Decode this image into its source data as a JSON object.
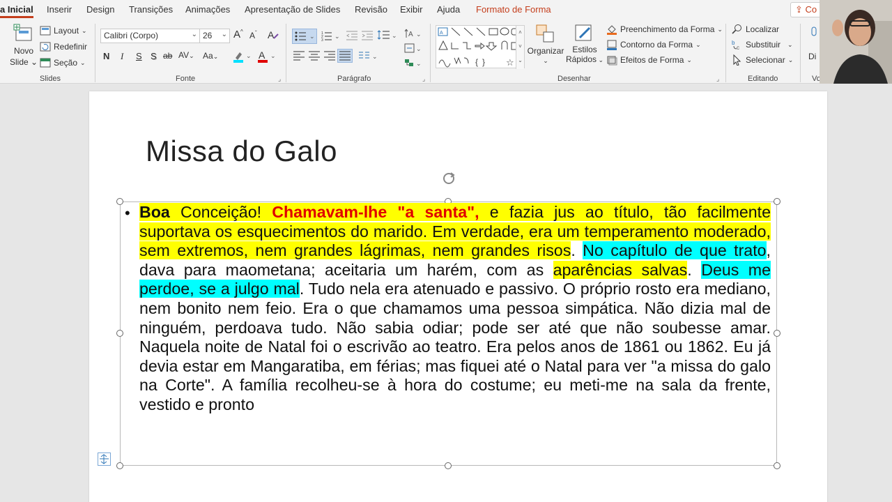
{
  "tabs": [
    {
      "label": "a Inicial",
      "active": true
    },
    {
      "label": "Inserir"
    },
    {
      "label": "Design"
    },
    {
      "label": "Transições"
    },
    {
      "label": "Animações"
    },
    {
      "label": "Apresentação de Slides"
    },
    {
      "label": "Revisão"
    },
    {
      "label": "Exibir"
    },
    {
      "label": "Ajuda"
    },
    {
      "label": "Formato de Forma",
      "accent": true
    }
  ],
  "share_label": "Co",
  "ribbon": {
    "slides": {
      "new_slide_label": "Novo",
      "new_slide_label2": "Slide",
      "layout_label": "Layout",
      "reset_label": "Redefinir",
      "section_label": "Seção",
      "group_label": "Slides"
    },
    "font": {
      "font_name": "Calibri (Corpo)",
      "font_size": "26",
      "bold": "N",
      "italic": "I",
      "underline": "S",
      "shadow": "S",
      "strike": "ab",
      "spacing": "AV",
      "case": "Aa",
      "grow": "A",
      "shrink": "A",
      "group_label": "Fonte"
    },
    "paragraph": {
      "group_label": "Parágrafo"
    },
    "drawing": {
      "arrange_label": "Organizar",
      "quick_styles_label": "Estilos",
      "quick_styles_label2": "Rápidos",
      "fill_label": "Preenchimento da Forma",
      "outline_label": "Contorno da Forma",
      "effects_label": "Efeitos de Forma",
      "group_label": "Desenhar"
    },
    "editing": {
      "find_label": "Localizar",
      "replace_label": "Substituir",
      "select_label": "Selecionar",
      "group_label": "Editando"
    },
    "dictate": {
      "label": "Di",
      "group_label": "Vo"
    }
  },
  "slide": {
    "title": "Missa do Galo",
    "body_segments": [
      {
        "text": "Boa",
        "style": "bold hl-y"
      },
      {
        "text": " Conceição! ",
        "style": "hl-y"
      },
      {
        "text": "Chamavam-lhe \"a santa\", ",
        "style": "red hl-y"
      },
      {
        "text": "e fazia jus ao título, tão facilmente suportava os esquecimentos do marido. Em verdade, era um temperamento moderado, sem extremos, nem grandes lágrimas, nem grandes risos",
        "style": "hl-y"
      },
      {
        "text": ". ",
        "style": ""
      },
      {
        "text": "No capítulo de que trato",
        "style": "hl-c"
      },
      {
        "text": ", dava para maometana; aceitaria um harém, com as ",
        "style": ""
      },
      {
        "text": "aparências salvas",
        "style": "hl-y"
      },
      {
        "text": ". ",
        "style": ""
      },
      {
        "text": "Deus me perdoe, se a julgo mal",
        "style": "hl-c"
      },
      {
        "text": ". Tudo nela era atenuado e passivo. O próprio rosto era mediano, nem bonito nem feio. Era o que chamamos uma pessoa simpática. Não dizia mal de ninguém, perdoava tudo. Não sabia odiar; pode ser até que não soubesse amar. Naquela noite de Natal foi o escrivão ao teatro. Era pelos anos de 1861 ou 1862. Eu já devia estar em Mangaratiba, em férias; mas fiquei até o Natal para ver \"a missa do galo na Corte\". A família recolheu-se à hora do costume; eu meti-me na sala da frente, vestido e pronto",
        "style": ""
      }
    ]
  }
}
